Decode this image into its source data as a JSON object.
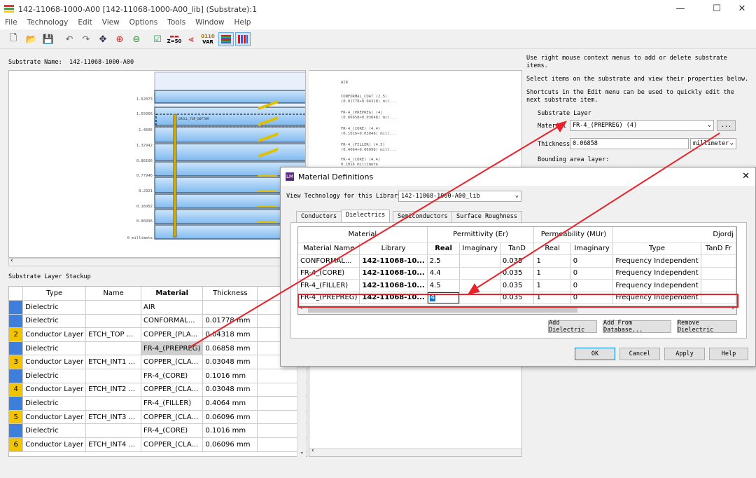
{
  "window": {
    "title": "142-11068-1000-A00 [142-11068-1000-A00_lib] (Substrate):1",
    "minimize": "—",
    "maximize": "☐",
    "close": "✕"
  },
  "menu": [
    "File",
    "Technology",
    "Edit",
    "View",
    "Options",
    "Tools",
    "Window",
    "Help"
  ],
  "toolbar": {
    "icons": [
      "new-file-icon",
      "open-folder-icon",
      "save-icon",
      "undo-icon",
      "redo-icon",
      "pan-icon",
      "zoom-in-icon",
      "zoom-out-icon",
      "check-icon",
      "z50-icon",
      "impedance-icon",
      "var-icon",
      "layer-view-icon",
      "column-view-icon"
    ],
    "z50_label": "Z=50",
    "var_label": "VAR",
    "var_sub": "0110"
  },
  "substrate": {
    "name_label": "Substrate Name:",
    "name_value": "142-11068-1000-A00"
  },
  "canvas": {
    "ylabels": [
      "1.62073",
      "1.55056",
      "1.4605",
      "1.32942",
      "0.86106",
      "0.77946",
      "0.2921",
      "0.16002",
      "0.06096",
      "0 millimete"
    ],
    "rlabels": [
      "AIR",
      "CONFORMAL_COAT (2.5)",
      "(0.01778+0.04318) mil...",
      "FR-4_(PREPREG) (4)",
      "(0.06858+0.03048) mil...",
      "FR-4_(CORE) (4.4)",
      "(0.1016+0.03048) mill...",
      "FR-4_(FILLER) (4.5)",
      "(0.4064+0.06096) mill...",
      "FR-4_(CORE) (4.4)",
      "0.1016 millimete"
    ],
    "via_label": "DRILL_TOP_BOTTOM"
  },
  "stackup": {
    "label": "Substrate Layer Stackup",
    "headers": [
      "Type",
      "Name",
      "Material",
      "Thickness"
    ],
    "rows": [
      {
        "num": "",
        "color": "#3f7fdc",
        "type": "Dielectric",
        "name": "",
        "material": "AIR",
        "thickness": ""
      },
      {
        "num": "",
        "color": "#3f7fdc",
        "type": "Dielectric",
        "name": "",
        "material": "CONFORMAL...",
        "thickness": "0.01778 mm"
      },
      {
        "num": "2",
        "color": "#f2c400",
        "type": "Conductor Layer",
        "name": "ETCH_TOP ...",
        "material": "COPPER_(PLA...",
        "thickness": "0.04318 mm"
      },
      {
        "num": "",
        "color": "#3f7fdc",
        "type": "Dielectric",
        "name": "",
        "material": "FR-4_(PREPREG)",
        "thickness": "0.06858 mm"
      },
      {
        "num": "3",
        "color": "#f2c400",
        "type": "Conductor Layer",
        "name": "ETCH_INT1 ...",
        "material": "COPPER_(CLA...",
        "thickness": "0.03048 mm"
      },
      {
        "num": "",
        "color": "#3f7fdc",
        "type": "Dielectric",
        "name": "",
        "material": "FR-4_(CORE)",
        "thickness": "0.1016 mm"
      },
      {
        "num": "4",
        "color": "#f2c400",
        "type": "Conductor Layer",
        "name": "ETCH_INT2 ...",
        "material": "COPPER_(CLA...",
        "thickness": "0.03048 mm"
      },
      {
        "num": "",
        "color": "#3f7fdc",
        "type": "Dielectric",
        "name": "",
        "material": "FR-4_(FILLER)",
        "thickness": "0.4064 mm"
      },
      {
        "num": "5",
        "color": "#f2c400",
        "type": "Conductor Layer",
        "name": "ETCH_INT3 ...",
        "material": "COPPER_(CLA...",
        "thickness": "0.06096 mm"
      },
      {
        "num": "",
        "color": "#3f7fdc",
        "type": "Dielectric",
        "name": "",
        "material": "FR-4_(CORE)",
        "thickness": "0.1016 mm"
      },
      {
        "num": "6",
        "color": "#f2c400",
        "type": "Conductor Layer",
        "name": "ETCH_INT4 ...",
        "material": "COPPER_(CLA...",
        "thickness": "0.06096 mm"
      }
    ]
  },
  "help": {
    "line1": "Use right mouse context menus to add or delete substrate items.",
    "line2": "Select items on the substrate and view their properties below.",
    "line3": "Shortcuts in the Edit menu can be used to quickly edit the next substrate item."
  },
  "layerprops": {
    "group_label": "Substrate Layer",
    "material_label": "Material",
    "material_value": "FR-4_(PREPREG) (4)",
    "dots": "...",
    "thickness_label": "Thickness",
    "thickness_value": "0.06858",
    "unit_value": "millimeter",
    "bounding_label": "Bounding area layer:"
  },
  "dialog": {
    "title": "Material Definitions",
    "icon_text": "LM",
    "view_tech_label": "View Technology for this Library:",
    "view_tech_value": "142-11068-1000-A00_lib",
    "tabs": [
      "Conductors",
      "Dielectrics",
      "Semiconductors",
      "Surface Roughness"
    ],
    "group_headers": [
      "Material",
      "Permittivity (Er)",
      "Permeability (MUr)",
      "Djordj"
    ],
    "col_headers": [
      "Material Name",
      "Library",
      "Real",
      "Imaginary",
      "TanD",
      "Real",
      "Imaginary",
      "Type",
      "TanD Fr"
    ],
    "rows": [
      [
        "CONFORMAL...",
        "142-11068-10...",
        "2.5",
        "",
        "0.035",
        "1",
        "0",
        "Frequency Independent",
        ""
      ],
      [
        "FR-4_(CORE)",
        "142-11068-10...",
        "4.4",
        "",
        "0.035",
        "1",
        "0",
        "Frequency Independent",
        ""
      ],
      [
        "FR-4_(FILLER)",
        "142-11068-10...",
        "4.5",
        "",
        "0.035",
        "1",
        "0",
        "Frequency Independent",
        ""
      ],
      [
        "FR-4_(PREPREG)",
        "142-11068-10...",
        "4",
        "",
        "0.035",
        "1",
        "0",
        "Frequency Independent",
        ""
      ]
    ],
    "buttons": {
      "add_dielectric": "Add Dielectric",
      "add_from_db": "Add From Database...",
      "remove_dielectric": "Remove Dielectric",
      "ok": "OK",
      "cancel": "Cancel",
      "apply": "Apply",
      "help": "Help"
    }
  },
  "colors": {
    "accent": "#0078d7",
    "highlight": "#e8222a",
    "dielectric": "#3f7fdc",
    "conductor": "#f2c400"
  }
}
